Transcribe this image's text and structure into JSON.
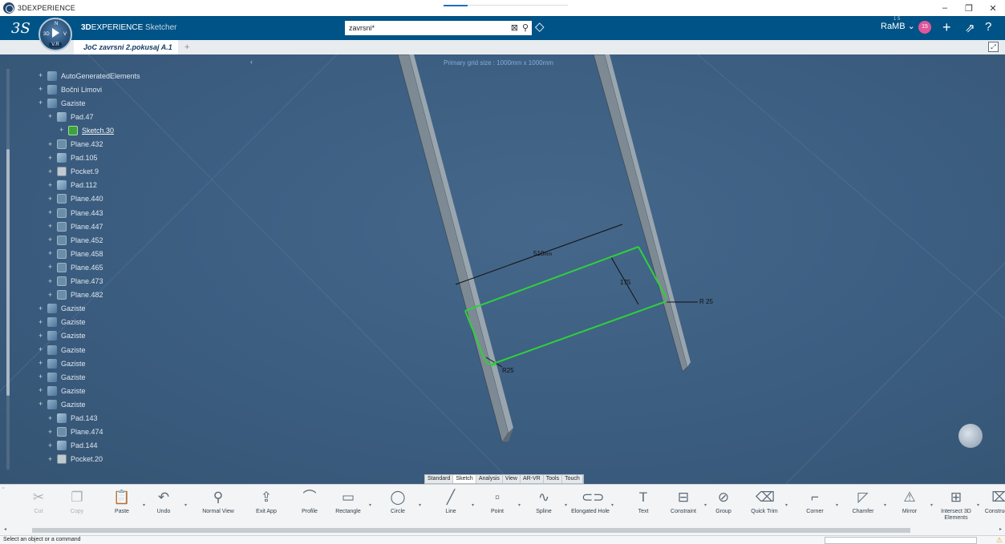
{
  "os": {
    "title": "3DEXPERIENCE",
    "controls": [
      "–",
      "❐",
      "✕"
    ]
  },
  "topbar": {
    "brand_bold": "3D",
    "brand_rest": "EXPERIENCE",
    "app_name": "Sketcher",
    "compass_left": "3D",
    "compass_right": "V",
    "compass_top": "N",
    "compass_version": "V.R",
    "search_value": "zavrsni*",
    "user": "RaMB",
    "user_sup": "1 5",
    "notifications": "15"
  },
  "tab": {
    "label": "JoC zavrsni 2.pokusaj A.1",
    "add": "+"
  },
  "viewport": {
    "grid_label": "Primary grid size : 1000mm x 1000mm",
    "collapse": "‹"
  },
  "tree": [
    {
      "label": "AutoGeneratedElements",
      "icon": "body-icon",
      "level": 1
    },
    {
      "label": "Bočni Limovi",
      "icon": "body-icon",
      "level": 1
    },
    {
      "label": "Gaziste",
      "icon": "body-icon",
      "level": 1
    },
    {
      "label": "Pad.47",
      "icon": "pad-icon",
      "level": 2
    },
    {
      "label": "Sketch.30",
      "icon": "sketch-icon",
      "level": 3,
      "active": true
    },
    {
      "label": "Plane.432",
      "icon": "plane-icon",
      "level": 2
    },
    {
      "label": "Pad.105",
      "icon": "pad-icon",
      "level": 2
    },
    {
      "label": "Pocket.9",
      "icon": "pocket-icon",
      "level": 2
    },
    {
      "label": "Pad.112",
      "icon": "pad-icon",
      "level": 2
    },
    {
      "label": "Plane.440",
      "icon": "plane-icon",
      "level": 2
    },
    {
      "label": "Plane.443",
      "icon": "plane-icon",
      "level": 2
    },
    {
      "label": "Plane.447",
      "icon": "plane-icon",
      "level": 2
    },
    {
      "label": "Plane.452",
      "icon": "plane-icon",
      "level": 2
    },
    {
      "label": "Plane.458",
      "icon": "plane-icon",
      "level": 2
    },
    {
      "label": "Plane.465",
      "icon": "plane-icon",
      "level": 2
    },
    {
      "label": "Plane.473",
      "icon": "plane-icon",
      "level": 2
    },
    {
      "label": "Plane.482",
      "icon": "plane-icon",
      "level": 2
    },
    {
      "label": "Gaziste",
      "icon": "body-icon",
      "level": 1
    },
    {
      "label": "Gaziste",
      "icon": "body-icon",
      "level": 1
    },
    {
      "label": "Gaziste",
      "icon": "body-icon",
      "level": 1
    },
    {
      "label": "Gaziste",
      "icon": "body-icon",
      "level": 1
    },
    {
      "label": "Gaziste",
      "icon": "body-icon",
      "level": 1
    },
    {
      "label": "Gaziste",
      "icon": "body-icon",
      "level": 1
    },
    {
      "label": "Gaziste",
      "icon": "body-icon",
      "level": 1
    },
    {
      "label": "Gaziste",
      "icon": "body-icon",
      "level": 1
    },
    {
      "label": "Pad.143",
      "icon": "pad-icon",
      "level": 2
    },
    {
      "label": "Plane.474",
      "icon": "plane-icon",
      "level": 2
    },
    {
      "label": "Pad.144",
      "icon": "pad-icon",
      "level": 2
    },
    {
      "label": "Pocket.20",
      "icon": "pocket-icon",
      "level": 2
    }
  ],
  "sketch": {
    "dim_length": "510",
    "dim_length_suffix": "mm",
    "dim_width": "175",
    "radius_1": "R 25",
    "radius_2": "R25",
    "line_color": "#2ed13a",
    "dim_color": "#111111"
  },
  "action_tabs": [
    "Standard",
    "Sketch",
    "Analysis",
    "View",
    "AR-VR",
    "Tools",
    "Touch"
  ],
  "commands": [
    {
      "label": "Cut",
      "icon": "cut-icon",
      "disabled": true
    },
    {
      "label": "Copy",
      "icon": "copy-icon",
      "disabled": true
    },
    {
      "label": "Paste",
      "icon": "paste-icon"
    },
    {
      "label": "Undo",
      "icon": "undo-icon"
    },
    {
      "label": "Normal View",
      "icon": "normal-view-icon"
    },
    {
      "label": "Exit App",
      "icon": "exit-app-icon"
    },
    {
      "label": "Profile",
      "icon": "profile-icon"
    },
    {
      "label": "Rectangle",
      "icon": "rectangle-icon"
    },
    {
      "label": "Circle",
      "icon": "circle-icon"
    },
    {
      "label": "Line",
      "icon": "line-icon"
    },
    {
      "label": "Point",
      "icon": "point-icon"
    },
    {
      "label": "Spline",
      "icon": "spline-icon"
    },
    {
      "label": "Elongated Hole",
      "icon": "elongated-hole-icon"
    },
    {
      "label": "Text",
      "icon": "text-icon"
    },
    {
      "label": "Constraint",
      "icon": "constraint-icon"
    },
    {
      "label": "Group",
      "icon": "group-icon"
    },
    {
      "label": "Quick Trim",
      "icon": "quick-trim-icon"
    },
    {
      "label": "Corner",
      "icon": "corner-icon"
    },
    {
      "label": "Chamfer",
      "icon": "chamfer-icon"
    },
    {
      "label": "Mirror",
      "icon": "mirror-icon"
    },
    {
      "label": "Intersect 3D Elements",
      "icon": "intersect-3d-icon"
    },
    {
      "label": "Construc El",
      "icon": "construction-icon"
    }
  ],
  "status": {
    "message": "Select an object or a command"
  }
}
